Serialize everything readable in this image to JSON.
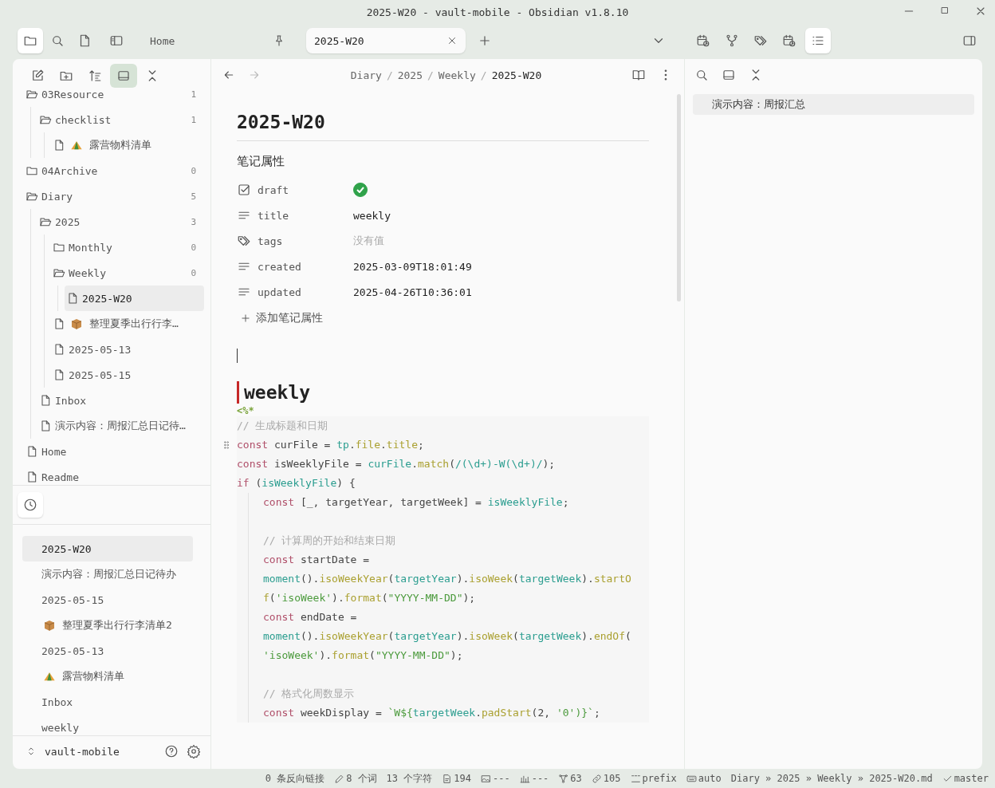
{
  "window": {
    "title": "2025-W20 - vault-mobile - Obsidian v1.8.10"
  },
  "ribbon": [
    {
      "kind": "folder",
      "selected": true
    },
    {
      "kind": "search",
      "selected": false
    },
    {
      "kind": "file",
      "selected": false
    }
  ],
  "tabs": [
    {
      "label": "Home",
      "selected": false,
      "pinned": true
    },
    {
      "label": "2025-W20",
      "selected": true,
      "pinned": false
    }
  ],
  "right_ribbon": [
    {
      "kind": "calendar",
      "selected": false
    },
    {
      "kind": "graph",
      "selected": false
    },
    {
      "kind": "tags",
      "selected": false
    },
    {
      "kind": "calendar",
      "selected": false
    },
    {
      "kind": "outline",
      "selected": true
    }
  ],
  "explorer": {
    "toolbar": [
      {
        "kind": "new-note",
        "selected": false
      },
      {
        "kind": "new-folder",
        "selected": false
      },
      {
        "kind": "sort",
        "selected": false
      },
      {
        "kind": "reveal",
        "selected": true
      },
      {
        "kind": "collapse",
        "selected": false
      }
    ],
    "tree": [
      {
        "name": "03Resource",
        "kind": "folder",
        "expanded": true,
        "count": "1",
        "selected": false,
        "children": [
          {
            "name": "checklist",
            "kind": "folder",
            "expanded": true,
            "count": "1",
            "selected": false,
            "children": [
              {
                "name": "露营物料清单",
                "kind": "file",
                "emblem": {
                  "kind": "tent"
                },
                "selected": false
              }
            ]
          }
        ]
      },
      {
        "name": "04Archive",
        "kind": "folder",
        "expanded": false,
        "count": "0",
        "selected": false
      },
      {
        "name": "Diary",
        "kind": "folder",
        "expanded": true,
        "count": "5",
        "selected": false,
        "children": [
          {
            "name": "2025",
            "kind": "folder",
            "expanded": true,
            "count": "3",
            "selected": false,
            "children": [
              {
                "name": "Monthly",
                "kind": "folder",
                "expanded": false,
                "count": "0",
                "selected": false
              },
              {
                "name": "Weekly",
                "kind": "folder",
                "expanded": true,
                "count": "0",
                "selected": false,
                "children": [
                  {
                    "name": "2025-W20",
                    "kind": "file",
                    "selected": true
                  }
                ]
              },
              {
                "name": "整理夏季出行行李…",
                "kind": "file",
                "emblem": {
                  "kind": "box"
                },
                "selected": false
              },
              {
                "name": "2025-05-13",
                "kind": "file",
                "selected": false
              },
              {
                "name": "2025-05-15",
                "kind": "file",
                "selected": false
              }
            ]
          },
          {
            "name": "Inbox",
            "kind": "file",
            "selected": false
          },
          {
            "name": "演示内容：周报汇总日记待…",
            "kind": "file",
            "selected": false
          }
        ]
      },
      {
        "name": "Home",
        "kind": "file",
        "selected": false
      },
      {
        "name": "Readme",
        "kind": "file",
        "selected": false
      }
    ]
  },
  "recent": {
    "items": [
      {
        "name": "2025-W20",
        "selected": true
      },
      {
        "name": "演示内容：周报汇总日记待办",
        "selected": false
      },
      {
        "name": "2025-05-15",
        "selected": false
      },
      {
        "name": "整理夏季出行行李清单2",
        "emblem": {
          "kind": "box"
        },
        "selected": false
      },
      {
        "name": "2025-05-13",
        "selected": false
      },
      {
        "name": "露营物料清单",
        "emblem": {
          "kind": "tent"
        },
        "selected": false
      },
      {
        "name": "Inbox",
        "selected": false
      },
      {
        "name": "weekly",
        "selected": false
      }
    ]
  },
  "vault": {
    "name": "vault-mobile"
  },
  "breadcrumb": [
    {
      "label": "Diary"
    },
    {
      "separator": "/",
      "label": "2025"
    },
    {
      "separator": "/",
      "label": "Weekly"
    },
    {
      "separator": "/",
      "label": "2025-W20"
    }
  ],
  "note": {
    "title": "2025-W20",
    "properties_heading": "笔记属性",
    "properties": [
      {
        "kind": "checkbox",
        "key": "draft",
        "checked": true
      },
      {
        "kind": "text",
        "key": "title",
        "value": "weekly"
      },
      {
        "kind": "tags",
        "key": "tags",
        "placeholder": "没有值"
      },
      {
        "kind": "text",
        "key": "created",
        "value": "2025-03-09T18:01:49"
      },
      {
        "kind": "text",
        "key": "updated",
        "value": "2025-04-26T10:36:01"
      }
    ],
    "add_property": "添加笔记属性",
    "heading": "weekly",
    "template_open": "<%*",
    "code": [
      {
        "kind": "code",
        "tokens": [
          {
            "t": "// 生成标题和日期",
            "kind": "comment"
          }
        ]
      },
      {
        "kind": "code",
        "handle": true,
        "tokens": [
          {
            "t": "const",
            "kind": "keyword"
          },
          {
            "t": " curFile = ",
            "kind": "plain"
          },
          {
            "t": "tp",
            "kind": "variable"
          },
          {
            "t": ".",
            "kind": "plain"
          },
          {
            "t": "file",
            "kind": "method"
          },
          {
            "t": ".",
            "kind": "plain"
          },
          {
            "t": "title",
            "kind": "method"
          },
          {
            "t": ";",
            "kind": "plain"
          }
        ]
      },
      {
        "kind": "code",
        "tokens": [
          {
            "t": "const",
            "kind": "keyword"
          },
          {
            "t": " isWeeklyFile = ",
            "kind": "plain"
          },
          {
            "t": "curFile",
            "kind": "variable"
          },
          {
            "t": ".",
            "kind": "plain"
          },
          {
            "t": "match",
            "kind": "method"
          },
          {
            "t": "(",
            "kind": "plain"
          },
          {
            "t": "/(\\d+)-W(\\d+)/",
            "kind": "variable"
          },
          {
            "t": ");",
            "kind": "plain"
          }
        ]
      },
      {
        "kind": "code",
        "tokens": [
          {
            "t": "if",
            "kind": "keyword"
          },
          {
            "t": " (",
            "kind": "plain"
          },
          {
            "t": "isWeeklyFile",
            "kind": "variable"
          },
          {
            "t": ") {",
            "kind": "plain"
          }
        ],
        "children": [
          {
            "kind": "code",
            "tokens": [
              {
                "t": "const",
                "kind": "keyword"
              },
              {
                "t": " [_, targetYear, targetWeek] = ",
                "kind": "plain"
              },
              {
                "t": "isWeeklyFile",
                "kind": "variable"
              },
              {
                "t": ";",
                "kind": "plain"
              }
            ]
          },
          {
            "kind": "blank"
          },
          {
            "kind": "code",
            "tokens": [
              {
                "t": "// 计算周的开始和结束日期",
                "kind": "comment"
              }
            ]
          },
          {
            "kind": "code",
            "tokens": [
              {
                "t": "const",
                "kind": "keyword"
              },
              {
                "t": " startDate =",
                "kind": "plain"
              }
            ]
          },
          {
            "kind": "code",
            "tokens": [
              {
                "t": "moment",
                "kind": "variable"
              },
              {
                "t": "().",
                "kind": "plain"
              },
              {
                "t": "isoWeekYear",
                "kind": "method"
              },
              {
                "t": "(",
                "kind": "plain"
              },
              {
                "t": "targetYear",
                "kind": "variable"
              },
              {
                "t": ").",
                "kind": "plain"
              },
              {
                "t": "isoWeek",
                "kind": "method"
              },
              {
                "t": "(",
                "kind": "plain"
              },
              {
                "t": "targetWeek",
                "kind": "variable"
              },
              {
                "t": ").",
                "kind": "plain"
              },
              {
                "t": "startO",
                "kind": "method"
              }
            ]
          },
          {
            "kind": "code",
            "tokens": [
              {
                "t": "f",
                "kind": "method"
              },
              {
                "t": "(",
                "kind": "plain"
              },
              {
                "t": "'isoWeek'",
                "kind": "string"
              },
              {
                "t": ").",
                "kind": "plain"
              },
              {
                "t": "format",
                "kind": "method"
              },
              {
                "t": "(",
                "kind": "plain"
              },
              {
                "t": "\"YYYY-MM-DD\"",
                "kind": "string"
              },
              {
                "t": ");",
                "kind": "plain"
              }
            ]
          },
          {
            "kind": "code",
            "tokens": [
              {
                "t": "const",
                "kind": "keyword"
              },
              {
                "t": " endDate =",
                "kind": "plain"
              }
            ]
          },
          {
            "kind": "code",
            "tokens": [
              {
                "t": "moment",
                "kind": "variable"
              },
              {
                "t": "().",
                "kind": "plain"
              },
              {
                "t": "isoWeekYear",
                "kind": "method"
              },
              {
                "t": "(",
                "kind": "plain"
              },
              {
                "t": "targetYear",
                "kind": "variable"
              },
              {
                "t": ").",
                "kind": "plain"
              },
              {
                "t": "isoWeek",
                "kind": "method"
              },
              {
                "t": "(",
                "kind": "plain"
              },
              {
                "t": "targetWeek",
                "kind": "variable"
              },
              {
                "t": ").",
                "kind": "plain"
              },
              {
                "t": "endOf",
                "kind": "method"
              },
              {
                "t": "(",
                "kind": "plain"
              }
            ]
          },
          {
            "kind": "code",
            "tokens": [
              {
                "t": "'isoWeek'",
                "kind": "string"
              },
              {
                "t": ").",
                "kind": "plain"
              },
              {
                "t": "format",
                "kind": "method"
              },
              {
                "t": "(",
                "kind": "plain"
              },
              {
                "t": "\"YYYY-MM-DD\"",
                "kind": "string"
              },
              {
                "t": ");",
                "kind": "plain"
              }
            ]
          },
          {
            "kind": "blank"
          },
          {
            "kind": "code",
            "tokens": [
              {
                "t": "// 格式化周数显示",
                "kind": "comment"
              }
            ]
          },
          {
            "kind": "code",
            "tokens": [
              {
                "t": "const",
                "kind": "keyword"
              },
              {
                "t": " weekDisplay = ",
                "kind": "plain"
              },
              {
                "t": "`W${",
                "kind": "string"
              },
              {
                "t": "targetWeek",
                "kind": "variable"
              },
              {
                "t": ".",
                "kind": "plain"
              },
              {
                "t": "padStart",
                "kind": "method"
              },
              {
                "t": "(2, ",
                "kind": "plain"
              },
              {
                "t": "'0'",
                "kind": "string"
              },
              {
                "t": ")}`",
                "kind": "string"
              },
              {
                "t": ";",
                "kind": "plain"
              }
            ]
          }
        ]
      }
    ]
  },
  "outline": {
    "items": [
      {
        "label": "演示内容：周报汇总",
        "selected": true
      }
    ]
  },
  "status_bar": [
    {
      "kind": "text",
      "text": "0 条反向链接"
    },
    {
      "kind": "pencil",
      "text": "8 个词"
    },
    {
      "kind": "text",
      "text": "13 个字符"
    },
    {
      "kind": "doc",
      "text": "194"
    },
    {
      "kind": "image",
      "text": "---"
    },
    {
      "kind": "chart",
      "text": "---"
    },
    {
      "kind": "nodes",
      "text": "63"
    },
    {
      "kind": "link",
      "text": "105"
    },
    {
      "kind": "dash",
      "text": "prefix"
    },
    {
      "kind": "keyboard",
      "text": "auto"
    },
    {
      "kind": "text",
      "text": "Diary » 2025 » Weekly » 2025-W20.md"
    },
    {
      "kind": "check",
      "text": "master"
    }
  ]
}
